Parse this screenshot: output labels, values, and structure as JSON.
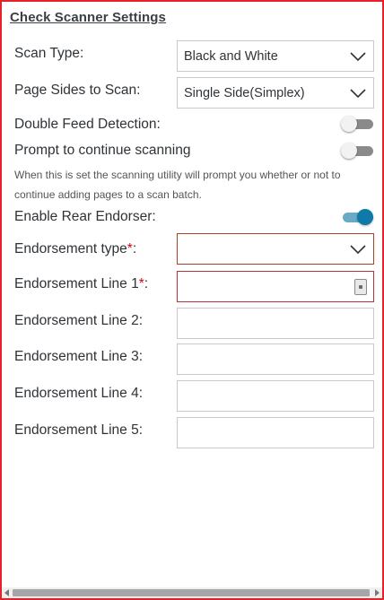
{
  "title": "Check Scanner Settings",
  "scan_type": {
    "label": "Scan Type:",
    "value": "Black and White"
  },
  "page_sides": {
    "label": "Page Sides to Scan:",
    "value": "Single Side(Simplex)"
  },
  "double_feed": {
    "label": "Double Feed Detection:",
    "enabled": false
  },
  "prompt_continue": {
    "label": "Prompt to continue scanning",
    "enabled": false,
    "help": "When this is set the scanning utility will prompt you whether or not to continue adding pages to a scan batch."
  },
  "rear_endorser": {
    "label": "Enable Rear Endorser:",
    "enabled": true
  },
  "endorsement_type": {
    "label": "Endorsement type",
    "required_mark": "*",
    "suffix": ":",
    "value": ""
  },
  "endorsement_lines": {
    "line1": {
      "label": "Endorsement Line 1",
      "required_mark": "*",
      "suffix": ":",
      "value": ""
    },
    "line2": {
      "label": "Endorsement Line 2:",
      "value": ""
    },
    "line3": {
      "label": "Endorsement Line 3:",
      "value": ""
    },
    "line4": {
      "label": "Endorsement Line 4:",
      "value": ""
    },
    "line5": {
      "label": "Endorsement Line 5:",
      "value": ""
    }
  },
  "colors": {
    "frame_border": "#e8202a",
    "toggle_on": "#0d7aa8",
    "required": "#d0021b",
    "error_border": "#b9333a"
  },
  "icons": {
    "dropdown": "chevron-down-icon",
    "field_helper": "lock-icon"
  }
}
